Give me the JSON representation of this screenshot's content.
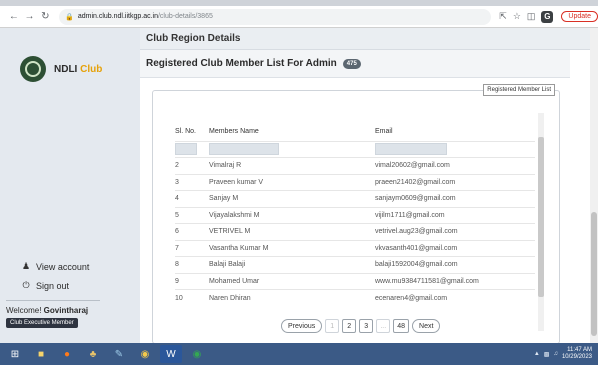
{
  "browser": {
    "url_host": "admin.club.ndl.iitkgp.ac.in",
    "url_path": "/club-details/3865",
    "update_label": "Update"
  },
  "sidebar": {
    "brand_ndli": "NDLI",
    "brand_club": "Club",
    "view_account": "View account",
    "sign_out": "Sign out",
    "welcome_prefix": "Welcome!",
    "user_name": "Govintharaj",
    "role": "Club Executive Member"
  },
  "main": {
    "region_title": "Club Region Details",
    "list_title": "Registered Club Member List For Admin",
    "member_count": "475",
    "card_tag": "Registered Member List",
    "columns": {
      "sl": "Sl. No.",
      "name": "Members Name",
      "email": "Email"
    },
    "rows": [
      {
        "sl": "2",
        "name": "Vimalraj R",
        "email": "vimal20602@gmail.com"
      },
      {
        "sl": "3",
        "name": "Praveen kumar V",
        "email": "praeen21402@gmail.com"
      },
      {
        "sl": "4",
        "name": "Sanjay M",
        "email": "sanjaym0609@gmail.com"
      },
      {
        "sl": "5",
        "name": "Vijayalakshmi M",
        "email": "vijilm1711@gmail.com"
      },
      {
        "sl": "6",
        "name": "VETRIVEL M",
        "email": "vetrivel.aug23@gmail.com"
      },
      {
        "sl": "7",
        "name": "Vasantha Kumar M",
        "email": "vkvasanth401@gmail.com"
      },
      {
        "sl": "8",
        "name": "Balaji Balaji",
        "email": "balaji1592004@gmail.com"
      },
      {
        "sl": "9",
        "name": "Mohamed Umar",
        "email": "www.mu9384711581@gmail.com"
      },
      {
        "sl": "10",
        "name": "Naren Dhiran",
        "email": "ecenaren4@gmail.com"
      }
    ],
    "pagination": {
      "previous": "Previous",
      "pages": [
        "1",
        "2",
        "3",
        "...",
        "48"
      ],
      "next": "Next"
    }
  },
  "taskbar": {
    "time": "11:47 AM",
    "date": "10/29/2023"
  }
}
